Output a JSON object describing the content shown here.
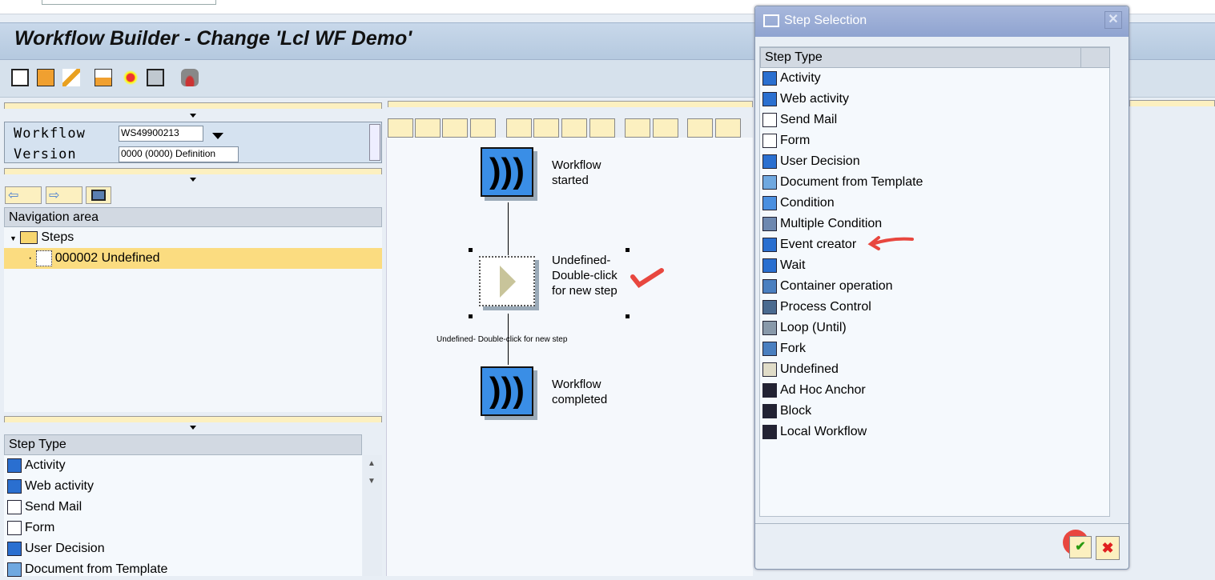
{
  "window": {
    "title": "Workflow Builder - Change 'Lcl WF Demo'"
  },
  "workflow_panel": {
    "workflow_label": "Workflow",
    "workflow_value": "WS49900213",
    "version_label": "Version",
    "version_value": "0000 (0000) Definition"
  },
  "navigation": {
    "header": "Navigation area",
    "folder": "Steps",
    "selected_item": "000002 Undefined"
  },
  "step_type_panel": {
    "header": "Step Type",
    "items": [
      "Activity",
      "Web activity",
      "Send Mail",
      "Form",
      "User Decision",
      "Document from Template"
    ]
  },
  "graph": {
    "start_label": "Workflow started",
    "undefined_label": "Undefined- Double-click for new step",
    "edge_label": "Undefined- Double-click for new step",
    "end_label": "Workflow completed"
  },
  "dialog": {
    "title": "Step Selection",
    "column_header": "Step Type",
    "items": [
      "Activity",
      "Web activity",
      "Send Mail",
      "Form",
      "User Decision",
      "Document from Template",
      "Condition",
      "Multiple Condition",
      "Event creator",
      "Wait",
      "Container operation",
      "Process Control",
      "Loop (Until)",
      "Fork",
      "Undefined",
      "Ad Hoc Anchor",
      "Block",
      "Local Workflow"
    ],
    "icon_colors": [
      "#2a6fd0",
      "#2a6fd0",
      "#ffffff",
      "#ffffff",
      "#2a6fd0",
      "#6fa8e0",
      "#4a8fe0",
      "#6d88b0",
      "#2a6fd0",
      "#2a6fd0",
      "#4a7fc0",
      "#4a6a90",
      "#8899aa",
      "#4a7fc0",
      "#e0dcc8",
      "#223",
      "#223",
      "#223"
    ]
  },
  "colors": {
    "selected_row": "#fbdc80",
    "annotation": "#e8473f"
  }
}
